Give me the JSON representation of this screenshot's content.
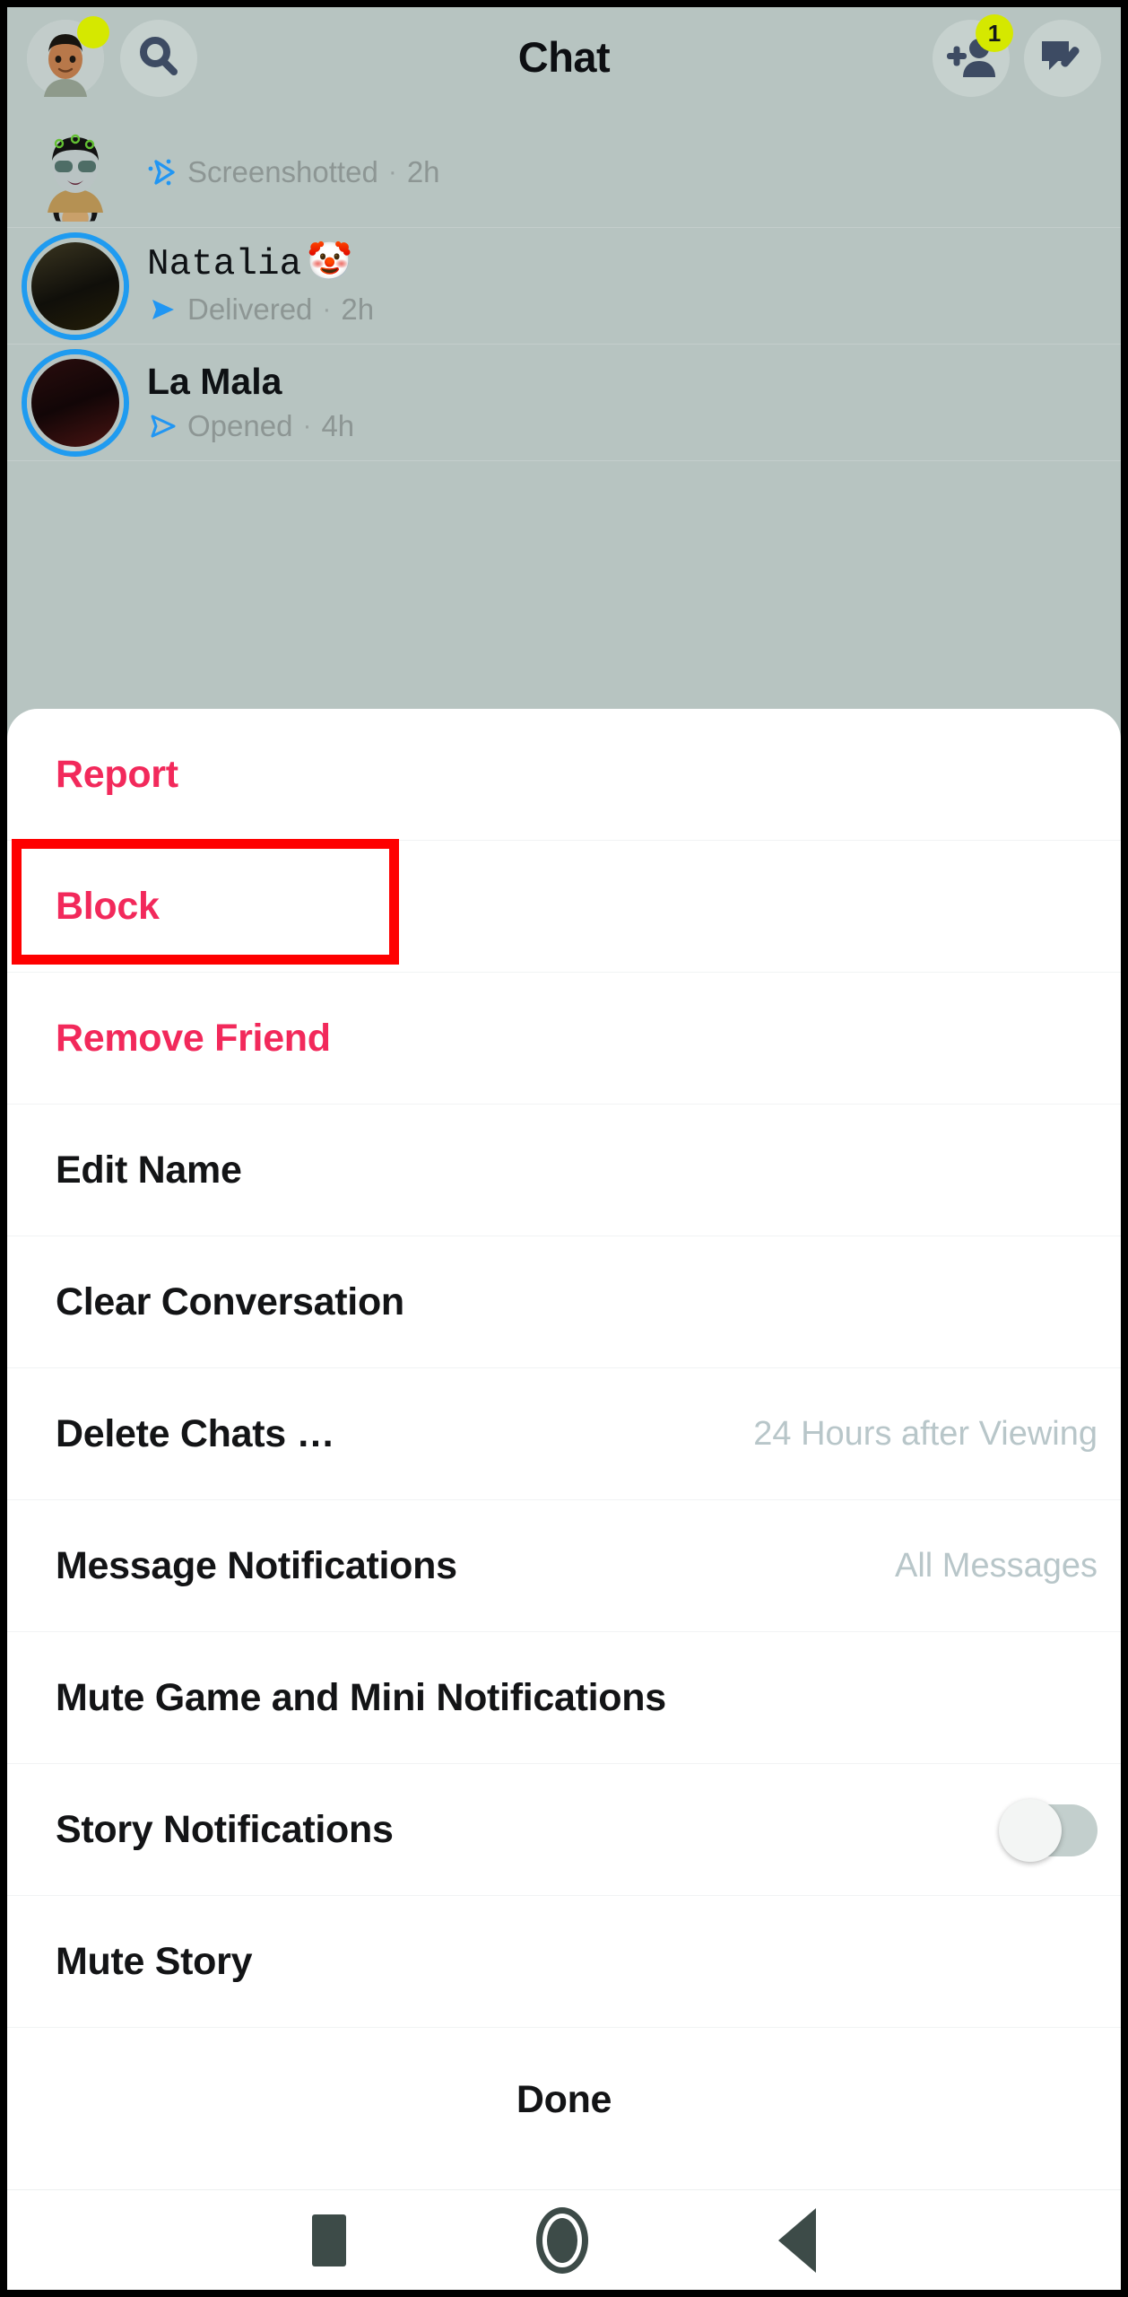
{
  "topbar": {
    "title": "Chat",
    "avatar_icon": "profile-bitmoji-avatar",
    "avatar_status_icon": "online-status-dot",
    "search_icon": "search-icon",
    "add_friend_icon": "add-friend-icon",
    "add_friend_badge": "1",
    "new_chat_icon": "new-chat-compose-icon"
  },
  "chat_list": [
    {
      "name": "",
      "status": "Screenshotted",
      "time": "2h",
      "status_icon": "screenshot-icon",
      "avatar_type": "bitmoji"
    },
    {
      "name": "Natalia",
      "emoji": "🤡",
      "status": "Delivered",
      "time": "2h",
      "status_icon": "delivered-filled-arrow-icon",
      "avatar_type": "snap-thumb-1"
    },
    {
      "name": "La Mala",
      "emoji": "",
      "status": "Opened",
      "time": "4h",
      "status_icon": "opened-outline-arrow-icon",
      "avatar_type": "snap-thumb-2"
    }
  ],
  "sheet": {
    "items": [
      {
        "label": "Report",
        "value": "",
        "danger": true,
        "toggle": null
      },
      {
        "label": "Block",
        "value": "",
        "danger": true,
        "toggle": null
      },
      {
        "label": "Remove Friend",
        "value": "",
        "danger": true,
        "toggle": null
      },
      {
        "label": "Edit Name",
        "value": "",
        "danger": false,
        "toggle": null
      },
      {
        "label": "Clear Conversation",
        "value": "",
        "danger": false,
        "toggle": null
      },
      {
        "label": "Delete Chats …",
        "value": "24 Hours after Viewing",
        "danger": false,
        "toggle": null
      },
      {
        "label": "Message Notifications",
        "value": "All Messages",
        "danger": false,
        "toggle": null
      },
      {
        "label": "Mute Game and Mini Notifications",
        "value": "",
        "danger": false,
        "toggle": null
      },
      {
        "label": "Story Notifications",
        "value": "",
        "danger": false,
        "toggle": "off"
      },
      {
        "label": "Mute Story",
        "value": "",
        "danger": false,
        "toggle": null
      }
    ],
    "done_label": "Done"
  },
  "highlight": {
    "target_label": "Block",
    "color": "#fe0000"
  },
  "navbar": {
    "recent_icon": "recent-apps-square-icon",
    "home_icon": "home-circle-icon",
    "back_icon": "back-triangle-icon"
  },
  "colors": {
    "app_background": "#b7c4c1",
    "danger_text": "#f2295b",
    "badge_yellow": "#d5e800",
    "ring_blue": "#1f9bf0",
    "muted_text": "#8d9694",
    "value_text": "#b8c6c9",
    "highlight_red": "#fe0000"
  }
}
